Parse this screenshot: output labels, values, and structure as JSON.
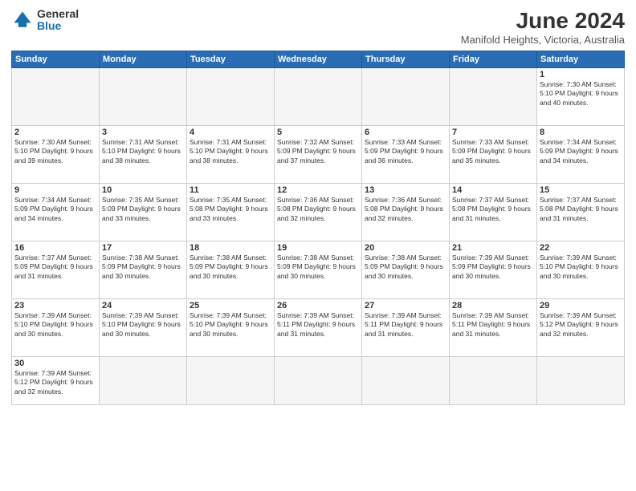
{
  "header": {
    "logo_general": "General",
    "logo_blue": "Blue",
    "month_title": "June 2024",
    "location": "Manifold Heights, Victoria, Australia"
  },
  "days_of_week": [
    "Sunday",
    "Monday",
    "Tuesday",
    "Wednesday",
    "Thursday",
    "Friday",
    "Saturday"
  ],
  "weeks": [
    [
      {
        "day": "",
        "info": ""
      },
      {
        "day": "",
        "info": ""
      },
      {
        "day": "",
        "info": ""
      },
      {
        "day": "",
        "info": ""
      },
      {
        "day": "",
        "info": ""
      },
      {
        "day": "",
        "info": ""
      },
      {
        "day": "1",
        "info": "Sunrise: 7:30 AM\nSunset: 5:10 PM\nDaylight: 9 hours\nand 40 minutes."
      }
    ],
    [
      {
        "day": "2",
        "info": "Sunrise: 7:30 AM\nSunset: 5:10 PM\nDaylight: 9 hours\nand 39 minutes."
      },
      {
        "day": "3",
        "info": "Sunrise: 7:31 AM\nSunset: 5:10 PM\nDaylight: 9 hours\nand 38 minutes."
      },
      {
        "day": "4",
        "info": "Sunrise: 7:31 AM\nSunset: 5:10 PM\nDaylight: 9 hours\nand 38 minutes."
      },
      {
        "day": "5",
        "info": "Sunrise: 7:32 AM\nSunset: 5:09 PM\nDaylight: 9 hours\nand 37 minutes."
      },
      {
        "day": "6",
        "info": "Sunrise: 7:33 AM\nSunset: 5:09 PM\nDaylight: 9 hours\nand 36 minutes."
      },
      {
        "day": "7",
        "info": "Sunrise: 7:33 AM\nSunset: 5:09 PM\nDaylight: 9 hours\nand 35 minutes."
      },
      {
        "day": "8",
        "info": "Sunrise: 7:34 AM\nSunset: 5:09 PM\nDaylight: 9 hours\nand 34 minutes."
      }
    ],
    [
      {
        "day": "9",
        "info": "Sunrise: 7:34 AM\nSunset: 5:09 PM\nDaylight: 9 hours\nand 34 minutes."
      },
      {
        "day": "10",
        "info": "Sunrise: 7:35 AM\nSunset: 5:09 PM\nDaylight: 9 hours\nand 33 minutes."
      },
      {
        "day": "11",
        "info": "Sunrise: 7:35 AM\nSunset: 5:08 PM\nDaylight: 9 hours\nand 33 minutes."
      },
      {
        "day": "12",
        "info": "Sunrise: 7:36 AM\nSunset: 5:08 PM\nDaylight: 9 hours\nand 32 minutes."
      },
      {
        "day": "13",
        "info": "Sunrise: 7:36 AM\nSunset: 5:08 PM\nDaylight: 9 hours\nand 32 minutes."
      },
      {
        "day": "14",
        "info": "Sunrise: 7:37 AM\nSunset: 5:08 PM\nDaylight: 9 hours\nand 31 minutes."
      },
      {
        "day": "15",
        "info": "Sunrise: 7:37 AM\nSunset: 5:08 PM\nDaylight: 9 hours\nand 31 minutes."
      }
    ],
    [
      {
        "day": "16",
        "info": "Sunrise: 7:37 AM\nSunset: 5:09 PM\nDaylight: 9 hours\nand 31 minutes."
      },
      {
        "day": "17",
        "info": "Sunrise: 7:38 AM\nSunset: 5:09 PM\nDaylight: 9 hours\nand 30 minutes."
      },
      {
        "day": "18",
        "info": "Sunrise: 7:38 AM\nSunset: 5:09 PM\nDaylight: 9 hours\nand 30 minutes."
      },
      {
        "day": "19",
        "info": "Sunrise: 7:38 AM\nSunset: 5:09 PM\nDaylight: 9 hours\nand 30 minutes."
      },
      {
        "day": "20",
        "info": "Sunrise: 7:38 AM\nSunset: 5:09 PM\nDaylight: 9 hours\nand 30 minutes."
      },
      {
        "day": "21",
        "info": "Sunrise: 7:39 AM\nSunset: 5:09 PM\nDaylight: 9 hours\nand 30 minutes."
      },
      {
        "day": "22",
        "info": "Sunrise: 7:39 AM\nSunset: 5:10 PM\nDaylight: 9 hours\nand 30 minutes."
      }
    ],
    [
      {
        "day": "23",
        "info": "Sunrise: 7:39 AM\nSunset: 5:10 PM\nDaylight: 9 hours\nand 30 minutes."
      },
      {
        "day": "24",
        "info": "Sunrise: 7:39 AM\nSunset: 5:10 PM\nDaylight: 9 hours\nand 30 minutes."
      },
      {
        "day": "25",
        "info": "Sunrise: 7:39 AM\nSunset: 5:10 PM\nDaylight: 9 hours\nand 30 minutes."
      },
      {
        "day": "26",
        "info": "Sunrise: 7:39 AM\nSunset: 5:11 PM\nDaylight: 9 hours\nand 31 minutes."
      },
      {
        "day": "27",
        "info": "Sunrise: 7:39 AM\nSunset: 5:11 PM\nDaylight: 9 hours\nand 31 minutes."
      },
      {
        "day": "28",
        "info": "Sunrise: 7:39 AM\nSunset: 5:11 PM\nDaylight: 9 hours\nand 31 minutes."
      },
      {
        "day": "29",
        "info": "Sunrise: 7:39 AM\nSunset: 5:12 PM\nDaylight: 9 hours\nand 32 minutes."
      }
    ],
    [
      {
        "day": "30",
        "info": "Sunrise: 7:39 AM\nSunset: 5:12 PM\nDaylight: 9 hours\nand 32 minutes."
      },
      {
        "day": "",
        "info": ""
      },
      {
        "day": "",
        "info": ""
      },
      {
        "day": "",
        "info": ""
      },
      {
        "day": "",
        "info": ""
      },
      {
        "day": "",
        "info": ""
      },
      {
        "day": "",
        "info": ""
      }
    ]
  ]
}
